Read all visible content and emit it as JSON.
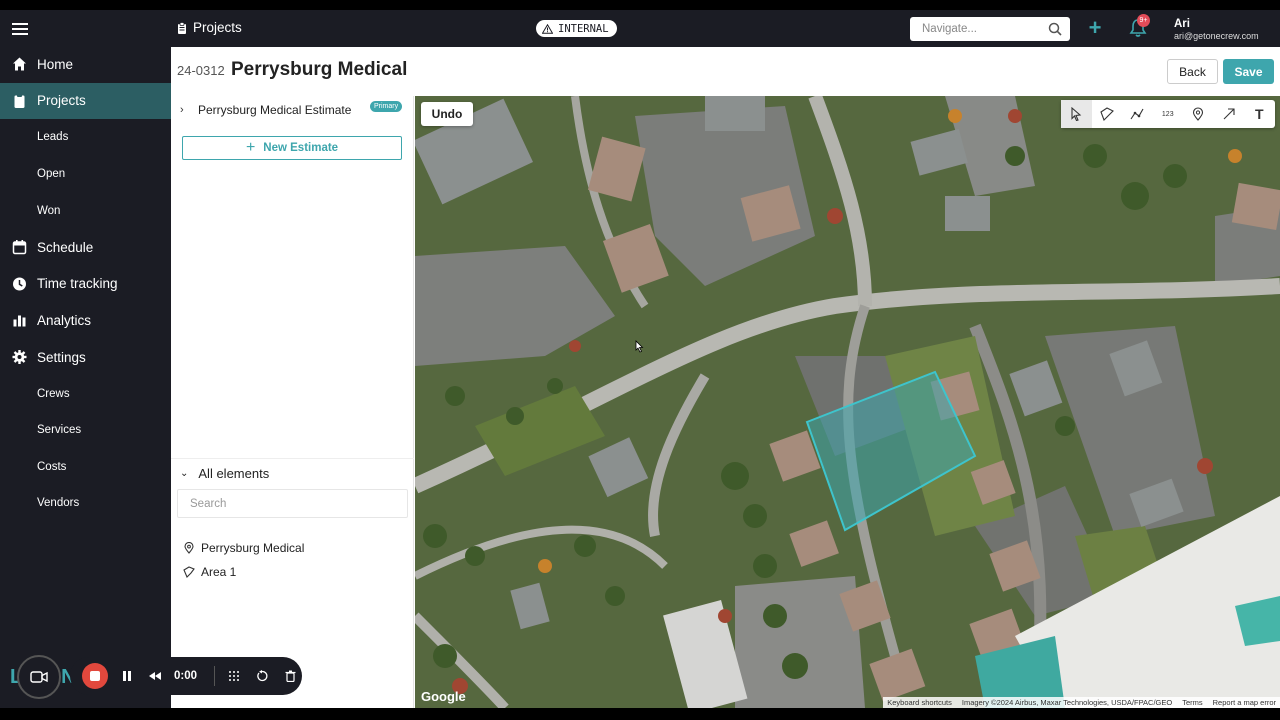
{
  "sidebar": {
    "items": [
      {
        "label": "Home",
        "type": "main",
        "icon": "home-icon",
        "active": false
      },
      {
        "label": "Projects",
        "type": "main",
        "icon": "clipboard-icon",
        "active": true
      },
      {
        "label": "Leads",
        "type": "sub"
      },
      {
        "label": "Open",
        "type": "sub"
      },
      {
        "label": "Won",
        "type": "sub"
      },
      {
        "label": "Schedule",
        "type": "main",
        "icon": "calendar-icon"
      },
      {
        "label": "Time tracking",
        "type": "main",
        "icon": "clock-icon"
      },
      {
        "label": "Analytics",
        "type": "main",
        "icon": "bar-chart-icon"
      },
      {
        "label": "Settings",
        "type": "main",
        "icon": "gear-icon"
      },
      {
        "label": "Crews",
        "type": "sub"
      },
      {
        "label": "Services",
        "type": "sub"
      },
      {
        "label": "Costs",
        "type": "sub"
      },
      {
        "label": "Vendors",
        "type": "sub"
      }
    ]
  },
  "topbar": {
    "breadcrumb": "Projects",
    "badge": "INTERNAL",
    "navigate_placeholder": "Navigate...",
    "notification_count": "9+",
    "user_name": "Ari",
    "user_email": "ari@getonecrew.com"
  },
  "header": {
    "project_number": "24-0312",
    "project_title": "Perrysburg Medical",
    "back_label": "Back",
    "save_label": "Save"
  },
  "panel": {
    "estimate_name": "Perrysburg Medical Estimate",
    "estimate_badge": "Primary",
    "new_estimate_label": "New Estimate",
    "all_elements_label": "All elements",
    "search_placeholder": "Search",
    "elements": [
      {
        "label": "Perrysburg Medical",
        "icon": "map-pin-icon"
      },
      {
        "label": "Area 1",
        "icon": "polygon-icon"
      }
    ]
  },
  "map": {
    "undo_label": "Undo",
    "tools": [
      "select-arrow-icon",
      "polygon-tool-icon",
      "polyline-tool-icon",
      "measure-tool-icon",
      "pin-tool-icon",
      "arrow-tool-icon",
      "text-tool-icon"
    ],
    "text_tool_label": "T",
    "measure_label": "123",
    "google_label": "Google",
    "attribution": [
      "Keyboard shortcuts",
      "Imagery ©2024 Airbus, Maxar Technologies, USDA/FPAC/GEO",
      "Terms",
      "Report a map error"
    ],
    "area_color": "#3ea6ad"
  },
  "recorder": {
    "time": "0:00"
  },
  "colors": {
    "accent": "#3ea6ad",
    "sidebar_bg": "#1b1c24",
    "active_nav": "#2c5e63"
  }
}
